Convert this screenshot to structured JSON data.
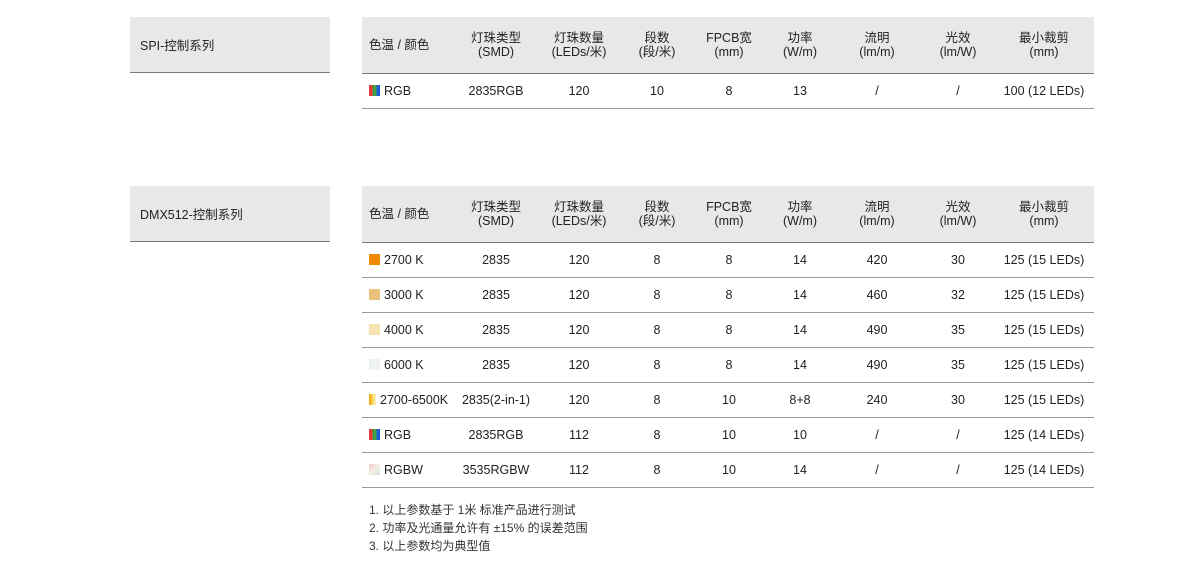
{
  "headers": {
    "c0": "色温 / 颜色",
    "c1": [
      "灯珠类型",
      "(SMD)"
    ],
    "c2": [
      "灯珠数量",
      "(LEDs/米)"
    ],
    "c3": [
      "段数",
      "(段/米)"
    ],
    "c4": [
      "FPCB宽",
      "(mm)"
    ],
    "c5": [
      "功率",
      "(W/m)"
    ],
    "c6": [
      "流明",
      "(lm/m)"
    ],
    "c7": [
      "光效",
      "(lm/W)"
    ],
    "c8": [
      "最小裁剪",
      "(mm)"
    ]
  },
  "sections": [
    {
      "title": "SPI-控制系列",
      "rows": [
        {
          "swatch": "rgb",
          "color": "RGB",
          "smd": "2835RGB",
          "leds": "120",
          "segments": "10",
          "fpcb": "8",
          "power": "13",
          "lumen": "/",
          "efficacy": "/",
          "min_cut": "100 (12 LEDs)"
        }
      ]
    },
    {
      "title": "DMX512-控制系列",
      "rows": [
        {
          "swatch": "#f08a00",
          "color": "2700 K",
          "smd": "2835",
          "leds": "120",
          "segments": "8",
          "fpcb": "8",
          "power": "14",
          "lumen": "420",
          "efficacy": "30",
          "min_cut": "125 (15 LEDs)"
        },
        {
          "swatch": "#e8c07c",
          "color": "3000 K",
          "smd": "2835",
          "leds": "120",
          "segments": "8",
          "fpcb": "8",
          "power": "14",
          "lumen": "460",
          "efficacy": "32",
          "min_cut": "125 (15 LEDs)"
        },
        {
          "swatch": "#f7e2b2",
          "color": "4000 K",
          "smd": "2835",
          "leds": "120",
          "segments": "8",
          "fpcb": "8",
          "power": "14",
          "lumen": "490",
          "efficacy": "35",
          "min_cut": "125 (15 LEDs)"
        },
        {
          "swatch": "#eef2ee",
          "color": "6000 K",
          "smd": "2835",
          "leds": "120",
          "segments": "8",
          "fpcb": "8",
          "power": "14",
          "lumen": "490",
          "efficacy": "35",
          "min_cut": "125 (15 LEDs)"
        },
        {
          "swatch": "cct",
          "color": "2700-6500K",
          "smd": "2835(2-in-1)",
          "leds": "120",
          "segments": "8",
          "fpcb": "10",
          "power": "8+8",
          "lumen": "240",
          "efficacy": "30",
          "min_cut": "125 (15 LEDs)"
        },
        {
          "swatch": "rgb",
          "color": "RGB",
          "smd": "2835RGB",
          "leds": "112",
          "segments": "8",
          "fpcb": "10",
          "power": "10",
          "lumen": "/",
          "efficacy": "/",
          "min_cut": "125 (14 LEDs)"
        },
        {
          "swatch": "rgbw",
          "color": "RGBW",
          "smd": "3535RGBW",
          "leds": "112",
          "segments": "8",
          "fpcb": "10",
          "power": "14",
          "lumen": "/",
          "efficacy": "/",
          "min_cut": "125 (14 LEDs)"
        }
      ]
    }
  ],
  "notes": [
    "1. 以上参数基于 1米 标准产品进行测试",
    "2. 功率及光通量允许有 ±15% 的误差范围",
    "3. 以上参数均为典型值"
  ]
}
